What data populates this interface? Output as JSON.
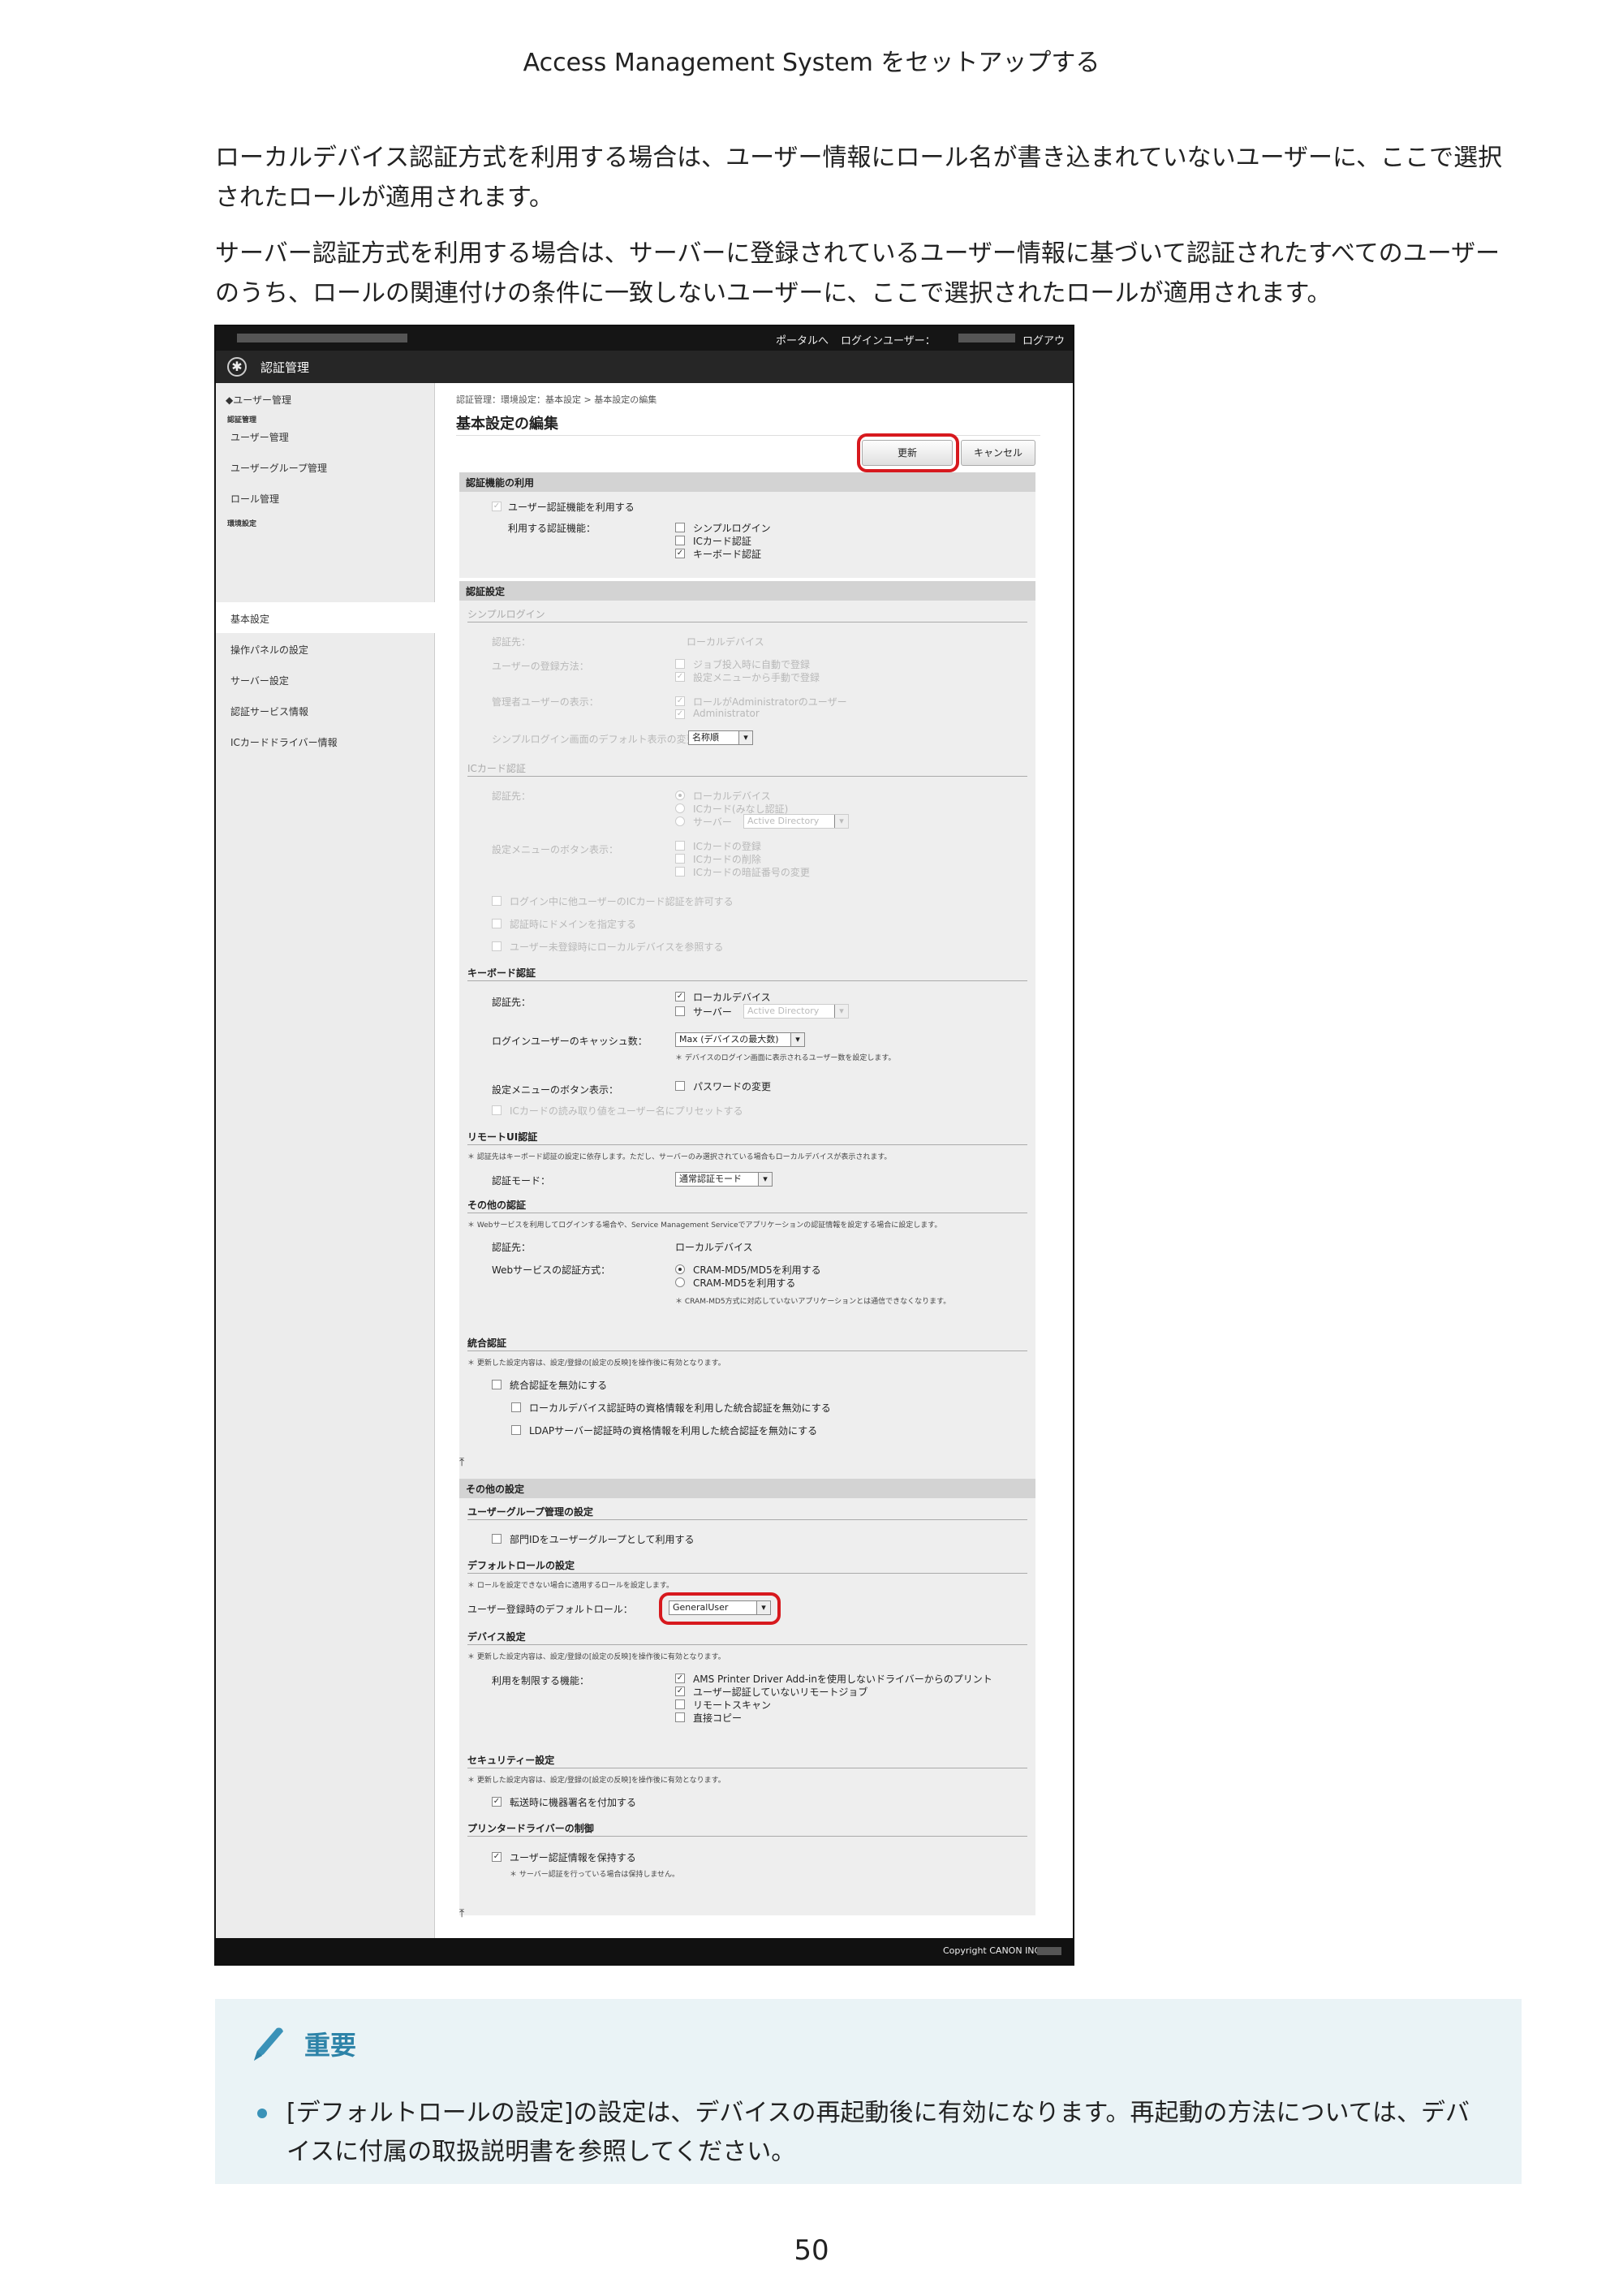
{
  "header": "Access Management System をセットアップする",
  "paragraphs": [
    "ローカルデバイス認証方式を利用する場合は、ユーザー情報にロール名が書き込まれていないユーザーに、ここで選択されたロールが適用されます。",
    "サーバー認証方式を利用する場合は、サーバーに登録されているユーザー情報に基づいて認証されたすべてのユーザーのうち、ロールの関連付けの条件に一致しないユーザーに、ここで選択されたロールが適用されます。"
  ],
  "screenshot": {
    "topbar": {
      "portal": "ポータルへ",
      "login_user": "ログインユーザー：",
      "logout": "ログアウト"
    },
    "app_title": "認証管理",
    "sidebar": {
      "back": "◆ユーザー管理",
      "group1": "認証管理",
      "items1": [
        "ユーザー管理",
        "ユーザーグループ管理",
        "ロール管理"
      ],
      "group2": "環境設定",
      "items2": [
        "基本設定",
        "操作パネルの設定",
        "サーバー設定",
        "認証サービス情報",
        "ICカードドライバー情報"
      ]
    },
    "breadcrumb": "認証管理：環境設定：基本設定 > 基本設定の編集",
    "page_title": "基本設定の編集",
    "buttons": {
      "update": "更新",
      "cancel": "キャンセル"
    },
    "auth_func": {
      "head": "認証機能の利用",
      "enable": "ユーザー認証機能を利用する",
      "use_label": "利用する認証機能：",
      "opts": [
        "シンプルログイン",
        "ICカード認証",
        "キーボード認証"
      ]
    },
    "auth_settings": {
      "head": "認証設定",
      "simple": {
        "title": "シンプルログイン",
        "dest_label": "認証先：",
        "dest_val": "ローカルデバイス",
        "reg_label": "ユーザーの登録方法：",
        "reg_opts": [
          "ジョブ投入時に自動で登録",
          "設定メニューから手動で登録"
        ],
        "admin_label": "管理者ユーザーの表示：",
        "admin_opts": [
          "ロールがAdministratorのユーザー",
          "Administrator"
        ],
        "default_label": "シンプルログイン画面のデフォルト表示の変更：",
        "default_val": "名称順"
      },
      "ic": {
        "title": "ICカード認証",
        "dest_label": "認証先：",
        "dest_opts": [
          "ローカルデバイス",
          "ICカード(みなし認証)",
          "サーバー"
        ],
        "server_val": "Active Directory",
        "menu_label": "設定メニューのボタン表示：",
        "menu_opts": [
          "ICカードの登録",
          "ICカードの削除",
          "ICカードの暗証番号の変更"
        ],
        "extra": [
          "ログイン中に他ユーザーのICカード認証を許可する",
          "認証時にドメインを指定する",
          "ユーザー未登録時にローカルデバイスを参照する"
        ]
      },
      "kb": {
        "title": "キーボード認証",
        "dest_label": "認証先：",
        "dest_opts": [
          "ローカルデバイス",
          "サーバー"
        ],
        "server_val": "Active Directory",
        "cache_label": "ログインユーザーのキャッシュ数：",
        "cache_val": "Max (デバイスの最大数)",
        "cache_note": "＊ デバイスのログイン画面に表示されるユーザー数を設定します。",
        "menu_label": "設定メニューのボタン表示：",
        "menu_opt": "パスワードの変更",
        "preset": "ICカードの読み取り値をユーザー名にプリセットする"
      },
      "remote": {
        "title": "リモートUI認証",
        "note": "＊ 認証先はキーボード認証の設定に依存します。ただし、サーバーのみ選択されている場合もローカルデバイスが表示されます。",
        "mode_label": "認証モード：",
        "mode_val": "通常認証モード"
      },
      "other_auth": {
        "title": "その他の認証",
        "note": "＊ Webサービスを利用してログインする場合や、Service Management Serviceでアプリケーションの認証情報を設定する場合に設定します。",
        "dest_label": "認証先：",
        "dest_val": "ローカルデバイス",
        "web_label": "Webサービスの認証方式：",
        "web_opts": [
          "CRAM-MD5/MD5を利用する",
          "CRAM-MD5を利用する"
        ],
        "web_note": "＊ CRAM-MD5方式に対応していないアプリケーションとは通信できなくなります。"
      },
      "integrated": {
        "title": "統合認証",
        "note": "＊ 更新した設定内容は、設定/登録の[設定の反映]を操作後に有効となります。",
        "disable": "統合認証を無効にする",
        "sub_opts": [
          "ローカルデバイス認証時の資格情報を利用した統合認証を無効にする",
          "LDAPサーバー認証時の資格情報を利用した統合認証を無効にする"
        ]
      }
    },
    "other_settings": {
      "head": "その他の設定",
      "ug": {
        "title": "ユーザーグループ管理の設定",
        "opt": "部門IDをユーザーグループとして利用する"
      },
      "role": {
        "title": "デフォルトロールの設定",
        "note": "＊ ロールを設定できない場合に適用するロールを設定します。",
        "label": "ユーザー登録時のデフォルトロール：",
        "val": "GeneralUser"
      },
      "device": {
        "title": "デバイス設定",
        "note": "＊ 更新した設定内容は、設定/登録の[設定の反映]を操作後に有効となります。",
        "label": "利用を制限する機能：",
        "opts": [
          "AMS Printer Driver Add-inを使用しないドライバーからのプリント",
          "ユーザー認証していないリモートジョブ",
          "リモートスキャン",
          "直接コピー"
        ]
      },
      "security": {
        "title": "セキュリティー設定",
        "note": "＊ 更新した設定内容は、設定/登録の[設定の反映]を操作後に有効となります。",
        "opt": "転送時に機器署名を付加する"
      },
      "driver": {
        "title": "プリンタードライバーの制御",
        "opt": "ユーザー認証情報を保持する",
        "note": "＊ サーバー認証を行っている場合は保持しません。"
      }
    },
    "copyright": "Copyright CANON INC."
  },
  "important": {
    "title": "重要",
    "text": "[デフォルトロールの設定]の設定は、デバイスの再起動後に有効になります。再起動の方法については、デバイスに付属の取扱説明書を参照してください。"
  },
  "page_number": "50",
  "colors": {
    "accent": "#2d83a8",
    "highlight": "#d7191e",
    "important_bg": "#eaf3f6"
  }
}
